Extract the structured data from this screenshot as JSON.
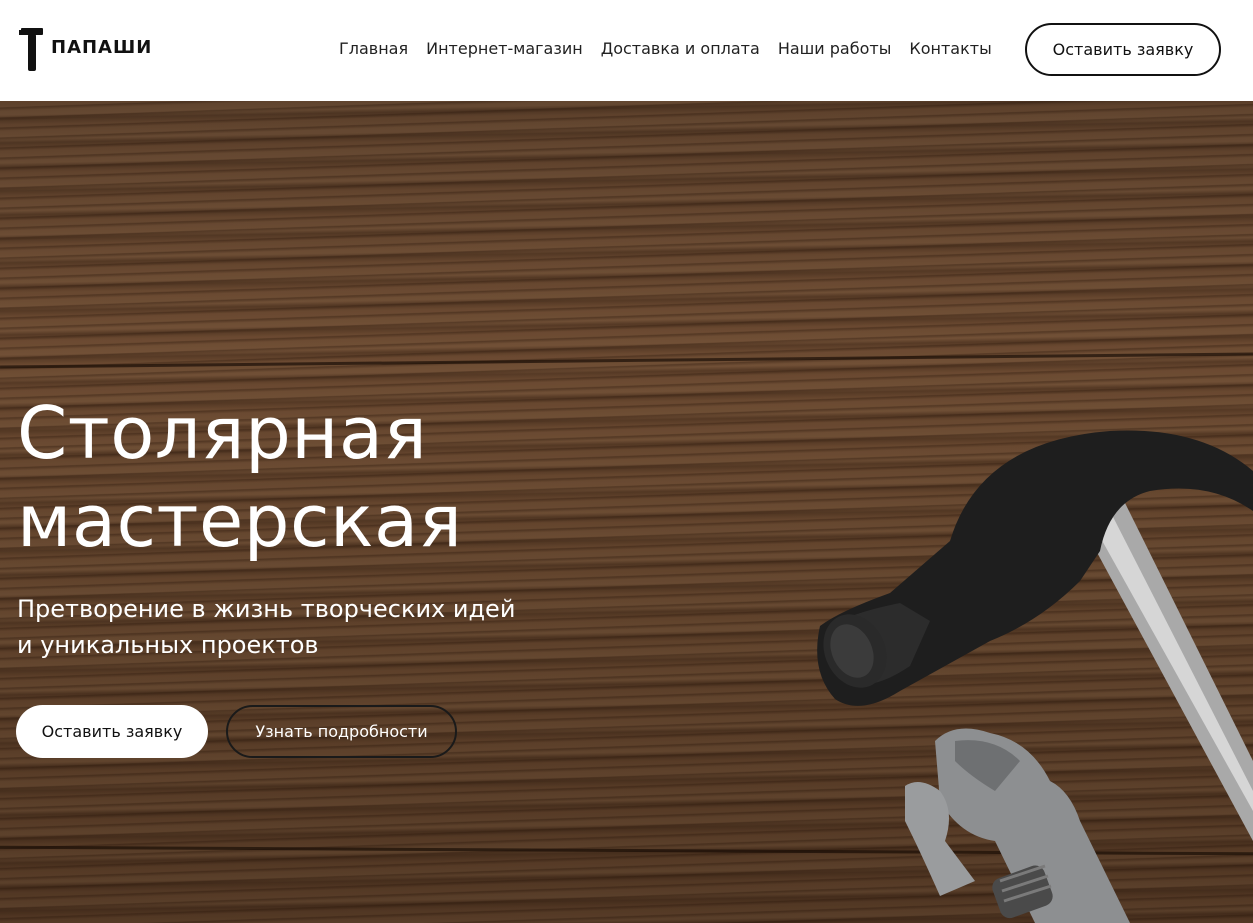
{
  "header": {
    "logo_text": "ПАПАШИ",
    "nav": [
      {
        "label": "Главная"
      },
      {
        "label": "Интернет-магазин"
      },
      {
        "label": "Доставка и оплата"
      },
      {
        "label": "Наши работы"
      },
      {
        "label": "Контакты"
      }
    ],
    "cta_label": "Оставить заявку"
  },
  "hero": {
    "title_lines": [
      "Столярная",
      "мастерская"
    ],
    "subtitle_lines": [
      "Претворение в жизнь творческих идей",
      "и уникальных проектов"
    ],
    "primary_button": "Оставить заявку",
    "secondary_button": "Узнать подробности",
    "background_image": "wood-table-with-hammer-and-wrench"
  },
  "colors": {
    "header_bg": "#ffffff",
    "text_dark": "#111111",
    "hero_text": "#ffffff",
    "wood": "#6e4c32"
  }
}
